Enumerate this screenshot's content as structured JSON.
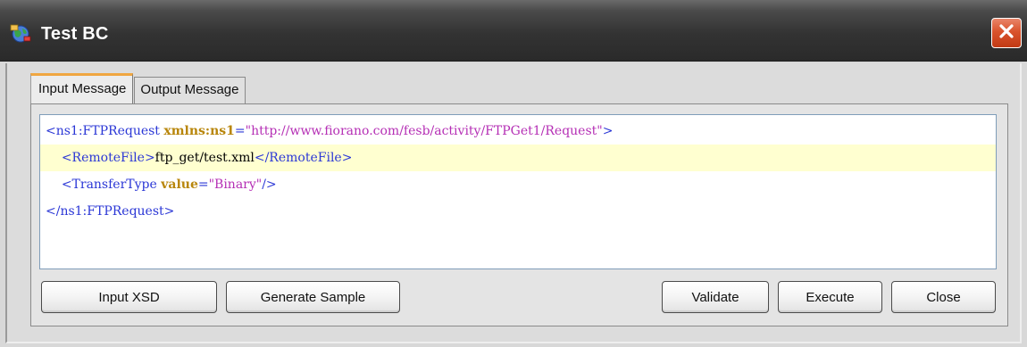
{
  "window": {
    "title": "Test BC",
    "icon": "app-globe-icon",
    "close_icon": "close-icon",
    "close_color": "#d9532c"
  },
  "tabs": [
    {
      "label": "Input Message",
      "active": true
    },
    {
      "label": "Output Message",
      "active": false
    }
  ],
  "editor": {
    "lines": [
      {
        "tokens": [
          {
            "type": "tag",
            "text": "<ns1:FTPRequest "
          },
          {
            "type": "attr",
            "text": "xmlns:ns1"
          },
          {
            "type": "tag",
            "text": "="
          },
          {
            "type": "val",
            "text": "\"http://www.fiorano.com/fesb/activity/FTPGet1/Request\""
          },
          {
            "type": "tag",
            "text": ">"
          }
        ],
        "highlighted": false
      },
      {
        "tokens": [
          {
            "type": "txt",
            "text": "    "
          },
          {
            "type": "tag",
            "text": "<RemoteFile>"
          },
          {
            "type": "txt",
            "text": "ftp_get/test.xml"
          },
          {
            "type": "tag",
            "text": "</RemoteFile>"
          }
        ],
        "highlighted": true
      },
      {
        "tokens": [
          {
            "type": "txt",
            "text": "    "
          },
          {
            "type": "tag",
            "text": "<TransferType "
          },
          {
            "type": "attr",
            "text": "value"
          },
          {
            "type": "tag",
            "text": "="
          },
          {
            "type": "val",
            "text": "\"Binary\""
          },
          {
            "type": "tag",
            "text": "/>"
          }
        ],
        "highlighted": false
      },
      {
        "tokens": [
          {
            "type": "tag",
            "text": "</ns1:FTPRequest>"
          }
        ],
        "highlighted": false
      }
    ]
  },
  "buttons": {
    "input_xsd": "Input XSD",
    "generate_sample": "Generate Sample",
    "validate": "Validate",
    "execute": "Execute",
    "close": "Close"
  }
}
